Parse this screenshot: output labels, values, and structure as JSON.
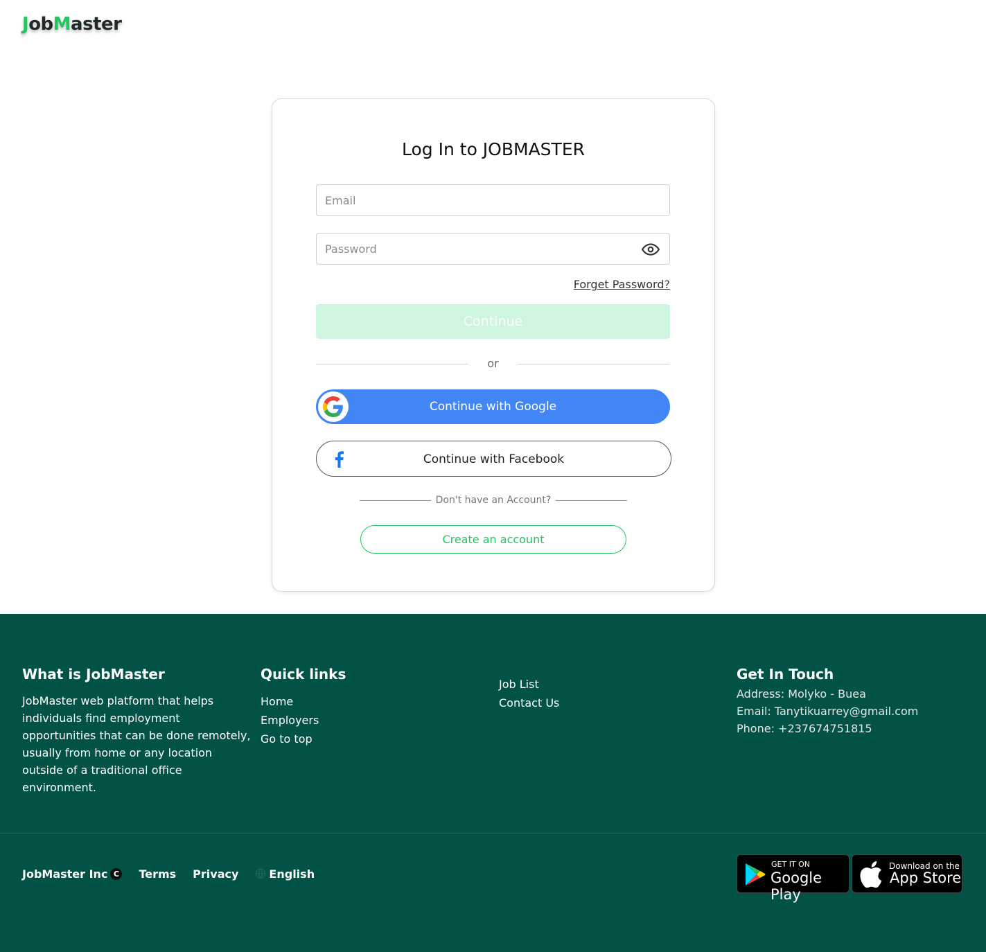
{
  "header": {
    "logo_j": "J",
    "logo_ob": "ob",
    "logo_m": "M",
    "logo_aster": "aster"
  },
  "login": {
    "title": "Log In to JOBMASTER",
    "email_placeholder": "Email",
    "password_placeholder": "Password",
    "forgot_label": "Forget Password?",
    "continue_label": "Continue",
    "or_label": "or",
    "google_label": "Continue with Google",
    "facebook_label": "Continue with Facebook",
    "no_account_label": "Don't have an Account?",
    "create_label": "Create an account"
  },
  "footer": {
    "about": {
      "heading": "What is JobMaster",
      "text": "JobMaster web platform that helps individuals find employment opportunities that can be done remotely, usually from home or any location outside of a traditional office environment."
    },
    "quick_links": {
      "heading": "Quick links",
      "items": [
        "Home",
        "Employers",
        "Go to top"
      ]
    },
    "more_links": [
      "Job List",
      "Contact Us"
    ],
    "contact": {
      "heading": "Get In Touch",
      "address": "Address: Molyko - Buea",
      "email": "Email: Tanytikuarrey@gmail.com",
      "phone": "Phone: +237674751815"
    },
    "bottom": {
      "brand": "JobMaster Inc",
      "copyright_symbol": "C",
      "terms": "Terms",
      "privacy": "Privacy",
      "language": "English"
    },
    "stores": {
      "google_small": "GET IT ON",
      "google_big": "Google Play",
      "apple_small": "Download on the",
      "apple_big": "App Store"
    }
  },
  "colors": {
    "brand_green": "#22c55e",
    "footer_bg": "#025246",
    "google_blue": "#4285f4",
    "continue_disabled": "#cdf5df"
  }
}
